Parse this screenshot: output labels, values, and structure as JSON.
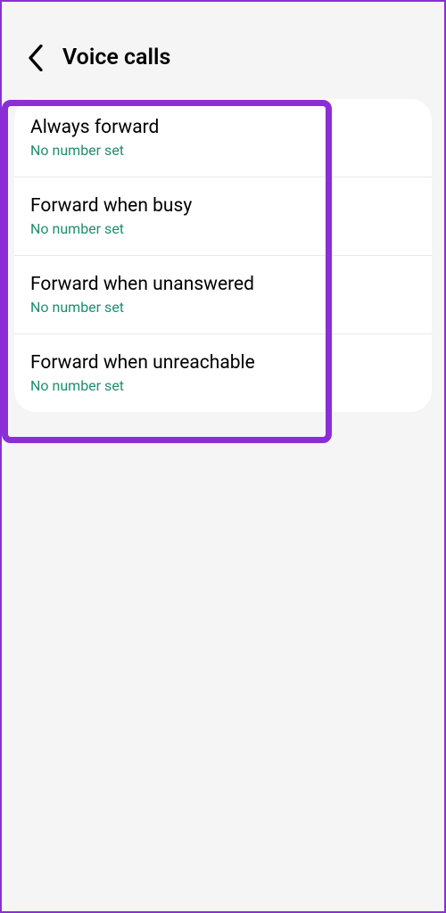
{
  "header": {
    "title": "Voice calls"
  },
  "items": [
    {
      "title": "Always forward",
      "subtitle": "No number set"
    },
    {
      "title": "Forward when busy",
      "subtitle": "No number set"
    },
    {
      "title": "Forward when unanswered",
      "subtitle": "No number set"
    },
    {
      "title": "Forward when unreachable",
      "subtitle": "No number set"
    }
  ],
  "highlightColor": "#8c2ed6"
}
